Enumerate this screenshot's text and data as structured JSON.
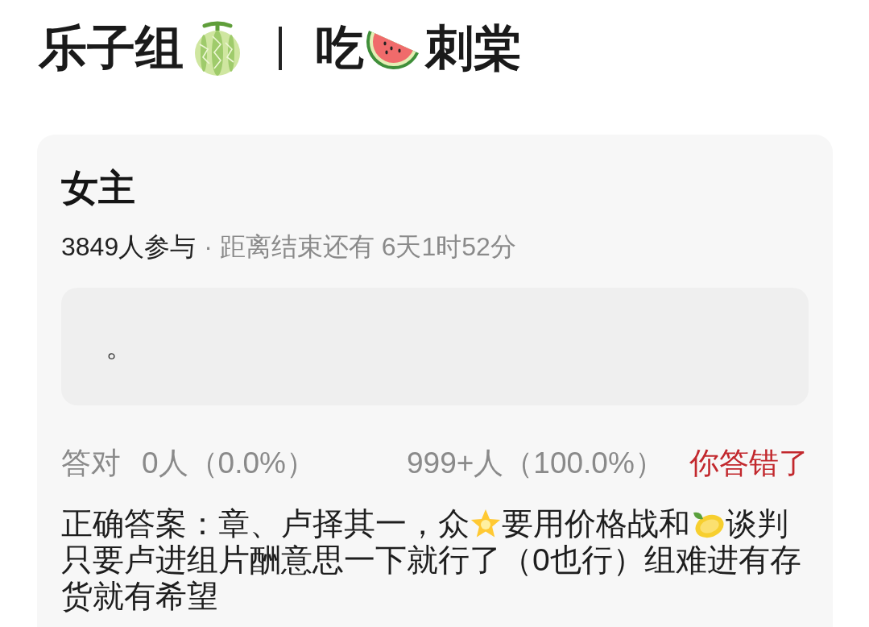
{
  "title": {
    "parts": [
      {
        "kind": "text",
        "text": "乐子组"
      },
      {
        "kind": "melon"
      },
      {
        "kind": "divider"
      },
      {
        "kind": "text",
        "text": "吃"
      },
      {
        "kind": "watermelon"
      },
      {
        "kind": "text",
        "text": "刺棠"
      }
    ]
  },
  "poll": {
    "title": "女主",
    "participants": "3849人参与",
    "countdown": "· 距离结束还有 6天1时52分",
    "my_answer": "。",
    "result": {
      "correct_label": "答对",
      "correct_count": "0人（0.0%）",
      "wrong_count": "999+人（100.0%）",
      "verdict": "你答错了",
      "answered_correctly": false
    },
    "solution": {
      "parts": [
        {
          "kind": "text",
          "text": "正确答案：章、卢择其一，众"
        },
        {
          "kind": "star"
        },
        {
          "kind": "text",
          "text": "要用价格战和"
        },
        {
          "kind": "lemon"
        },
        {
          "kind": "text",
          "text": "谈判只要卢进组片酬意思一下就行了（0也行）组难进有存货就有希望"
        }
      ]
    }
  }
}
